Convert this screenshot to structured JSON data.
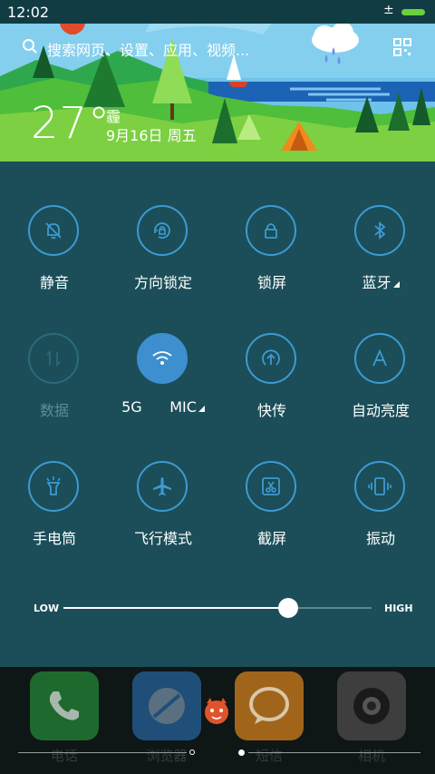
{
  "status_bar": {
    "time": "12:02",
    "signal": "±"
  },
  "header": {
    "search_placeholder": "搜索网页、设置、应用、视频...",
    "temperature": "27°",
    "condition": "霾",
    "date": "9月16日 周五"
  },
  "tiles": [
    {
      "label": "静音",
      "icon": "bell-slash-icon",
      "active": false,
      "dim": false
    },
    {
      "label": "方向锁定",
      "icon": "rotation-lock-icon",
      "active": false,
      "dim": false
    },
    {
      "label": "锁屏",
      "icon": "lock-icon",
      "active": false,
      "dim": false
    },
    {
      "label": "蓝牙",
      "icon": "bluetooth-icon",
      "active": false,
      "dim": false,
      "has_menu": true
    },
    {
      "label": "数据",
      "icon": "data-arrows-icon",
      "active": false,
      "dim": true
    },
    {
      "label": "5G      MIC",
      "icon": "wifi-icon",
      "active": true,
      "dim": false,
      "has_menu": true
    },
    {
      "label": "快传",
      "icon": "quick-transfer-icon",
      "active": false,
      "dim": false
    },
    {
      "label": "自动亮度",
      "icon": "auto-brightness-icon",
      "active": false,
      "dim": false
    },
    {
      "label": "手电筒",
      "icon": "flashlight-icon",
      "active": false,
      "dim": false
    },
    {
      "label": "飞行模式",
      "icon": "airplane-icon",
      "active": false,
      "dim": false
    },
    {
      "label": "截屏",
      "icon": "screenshot-icon",
      "active": false,
      "dim": false
    },
    {
      "label": "振动",
      "icon": "vibrate-icon",
      "active": false,
      "dim": false
    }
  ],
  "brightness": {
    "low_label": "LOW",
    "high_label": "HIGH",
    "level": 0.73
  },
  "dock": {
    "apps": [
      {
        "label": "电话",
        "icon": "phone-icon",
        "color": "#1e6a2e"
      },
      {
        "label": "浏览器",
        "icon": "browser-icon",
        "color": "#1f4f78"
      },
      {
        "label": "短信",
        "icon": "message-icon",
        "color": "#a0651a"
      },
      {
        "label": "相机",
        "icon": "camera-icon",
        "color": "#3e3e3e"
      }
    ]
  },
  "colors": {
    "panel": "#1b4e58",
    "accent": "#3d9ad3",
    "active_tile": "#3d8fcf"
  }
}
